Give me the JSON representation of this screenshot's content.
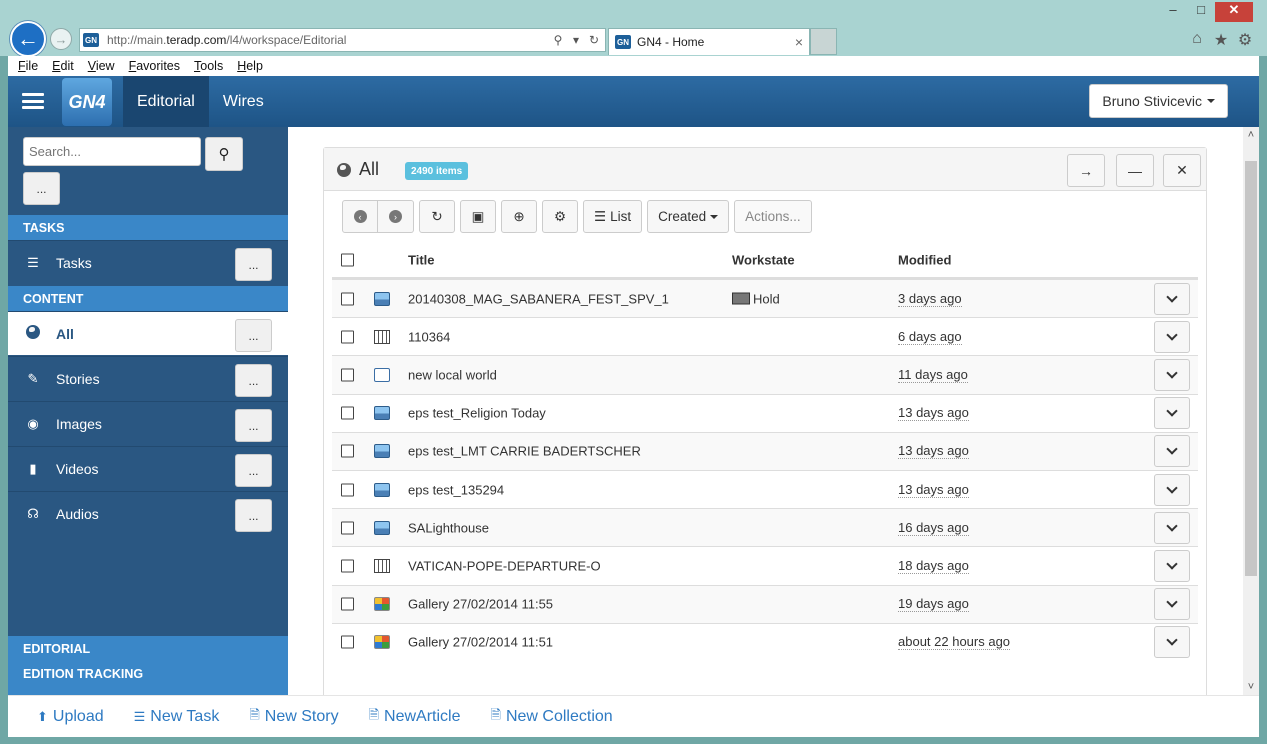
{
  "browser": {
    "url_prefix": "http://main.",
    "url_host": "teradp.com",
    "url_path": "/l4/workspace/Editorial",
    "tab_title": "GN4 - Home",
    "favicon": "GN",
    "menu": [
      "File",
      "Edit",
      "View",
      "Favorites",
      "Tools",
      "Help"
    ]
  },
  "app": {
    "logo": "GN4",
    "nav_tabs": [
      {
        "label": "Editorial",
        "active": true
      },
      {
        "label": "Wires",
        "active": false
      }
    ],
    "user_name": "Bruno Stivicevic"
  },
  "sidebar": {
    "search_placeholder": "Search...",
    "more_label": "...",
    "tasks_header": "TASKS",
    "tasks_item": "Tasks",
    "content_header": "CONTENT",
    "content_items": [
      {
        "label": "All",
        "icon": "globe-icon",
        "active": true
      },
      {
        "label": "Stories",
        "icon": "pencil-icon",
        "active": false
      },
      {
        "label": "Images",
        "icon": "camera-icon",
        "active": false
      },
      {
        "label": "Videos",
        "icon": "video-camera-icon",
        "active": false
      },
      {
        "label": "Audios",
        "icon": "headphones-icon",
        "active": false
      }
    ],
    "editorial_header": "EDITORIAL",
    "edition_tracking_header": "EDITION TRACKING"
  },
  "panel": {
    "title": "All",
    "items_badge": "2490 items",
    "toolbar": {
      "list_label": "List",
      "sort_label": "Created",
      "actions_label": "Actions..."
    },
    "columns": {
      "title": "Title",
      "workstate": "Workstate",
      "modified": "Modified"
    },
    "rows": [
      {
        "type": "image",
        "title": "20140308_MAG_SABANERA_FEST_SPV_1",
        "workstate": "Hold",
        "modified": "3 days ago"
      },
      {
        "type": "video",
        "title": "110364",
        "workstate": "",
        "modified": "6 days ago"
      },
      {
        "type": "story",
        "title": "new local world",
        "workstate": "",
        "modified": "11 days ago"
      },
      {
        "type": "image",
        "title": "eps test_Religion Today",
        "workstate": "",
        "modified": "13 days ago"
      },
      {
        "type": "image",
        "title": "eps test_LMT CARRIE BADERTSCHER",
        "workstate": "",
        "modified": "13 days ago"
      },
      {
        "type": "image",
        "title": "eps test_135294",
        "workstate": "",
        "modified": "13 days ago"
      },
      {
        "type": "image",
        "title": "SALighthouse",
        "workstate": "",
        "modified": "16 days ago"
      },
      {
        "type": "video",
        "title": "VATICAN-POPE-DEPARTURE-O",
        "workstate": "",
        "modified": "18 days ago"
      },
      {
        "type": "gallery",
        "title": "Gallery 27/02/2014 11:55",
        "workstate": "",
        "modified": "19 days ago"
      },
      {
        "type": "gallery",
        "title": "Gallery 27/02/2014 11:51",
        "workstate": "",
        "modified": "about 22 hours ago"
      }
    ]
  },
  "footer": {
    "upload": "Upload",
    "new_task": "New Task",
    "new_story": "New Story",
    "new_article": "NewArticle",
    "new_collection": "New Collection"
  },
  "colors": {
    "topbar": "#1e5486",
    "sidebar": "#2a5782",
    "section_header": "#3a87c8",
    "badge": "#5bc0de",
    "link": "#2e7ac2"
  }
}
